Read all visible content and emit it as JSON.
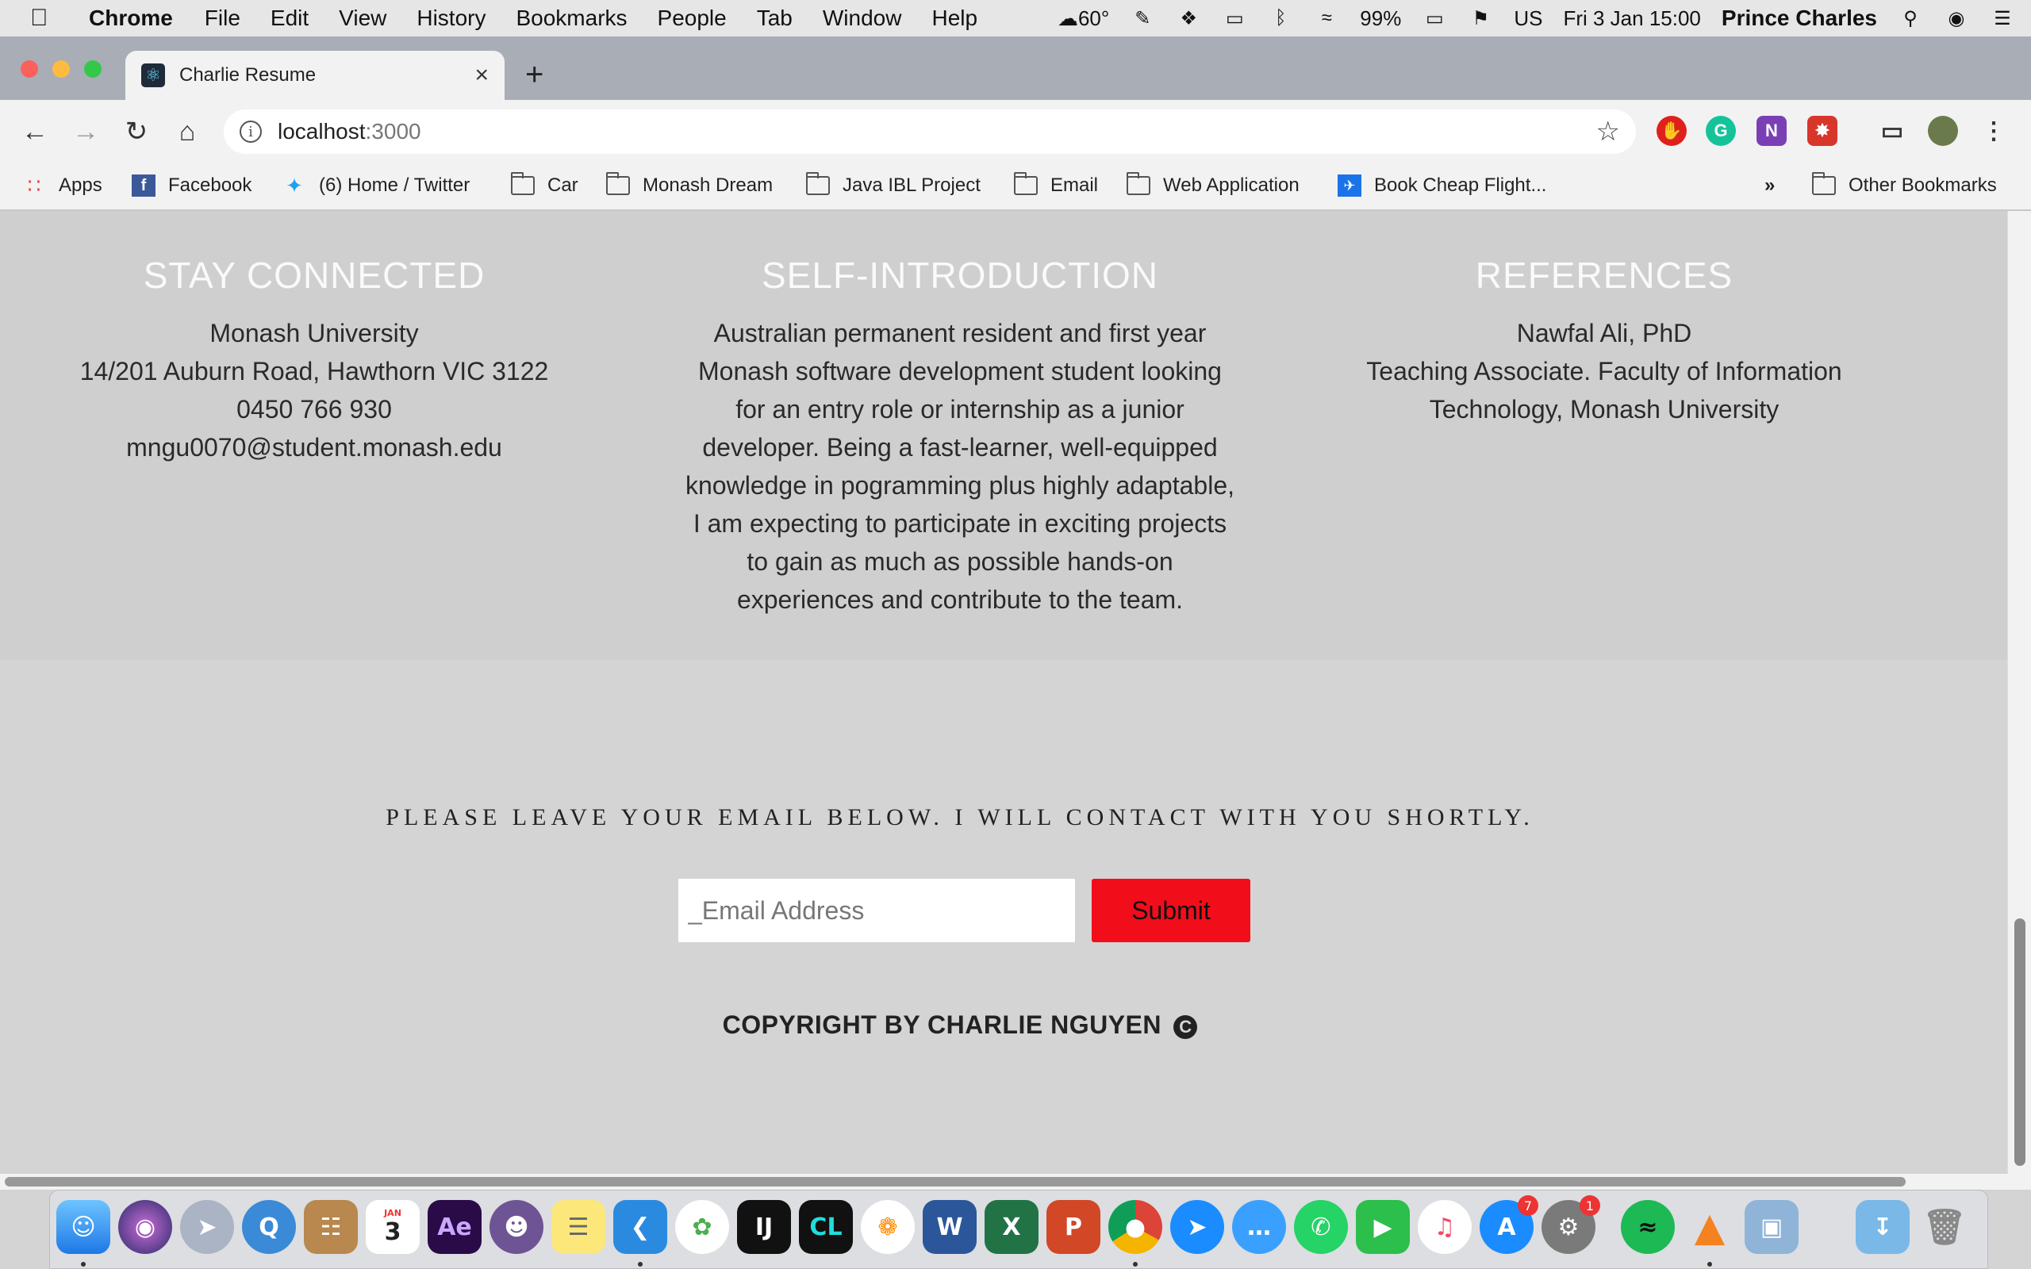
{
  "menubar": {
    "app_name": "Chrome",
    "items": [
      "File",
      "Edit",
      "View",
      "History",
      "Bookmarks",
      "People",
      "Tab",
      "Window",
      "Help"
    ],
    "temperature": "60°",
    "battery": "99%",
    "input_source": "US",
    "datetime": "Fri 3 Jan  15:00",
    "user": "Prince Charles"
  },
  "browser": {
    "tab_title": "Charlie Resume",
    "url_host": "localhost",
    "url_port": ":3000",
    "bookmarks": [
      {
        "label": "Apps",
        "icon": "apps-grid-icon"
      },
      {
        "label": "Facebook",
        "icon": "facebook-icon"
      },
      {
        "label": "(6) Home / Twitter",
        "icon": "twitter-icon"
      },
      {
        "label": "Car",
        "icon": "folder-icon"
      },
      {
        "label": "Monash Dream",
        "icon": "folder-icon"
      },
      {
        "label": "Java IBL Project",
        "icon": "folder-icon"
      },
      {
        "label": "Email",
        "icon": "folder-icon"
      },
      {
        "label": "Web Application",
        "icon": "folder-icon"
      },
      {
        "label": "Book Cheap Flight...",
        "icon": "flight-site-icon"
      }
    ],
    "overflow_label": "»",
    "other_bookmarks": "Other Bookmarks"
  },
  "page": {
    "stay_connected": {
      "title": "STAY CONNECTED",
      "lines": [
        "Monash University",
        "14/201 Auburn Road, Hawthorn VIC 3122",
        "0450 766 930",
        "mngu0070@student.monash.edu"
      ]
    },
    "self_intro": {
      "title": "SELF-INTRODUCTION",
      "lines": [
        "Australian permanent resident and first year",
        "Monash software development student looking",
        "for an entry role or internship as a junior",
        "developer. Being a fast-learner, well-equipped",
        "knowledge in pogramming plus highly adaptable,",
        "I am expecting to participate in exciting projects",
        "to gain as much as possible hands-on",
        "experiences and contribute to the team."
      ]
    },
    "references": {
      "title": "REFERENCES",
      "lines": [
        "Nawfal Ali, PhD",
        "Teaching Associate. Faculty of Information",
        "Technology, Monash University"
      ]
    },
    "contact_prompt": "PLEASE LEAVE YOUR EMAIL BELOW. I WILL CONTACT WITH YOU SHORTLY.",
    "email_placeholder": "_Email Address",
    "submit_label": "Submit",
    "copyright": "COPYRIGHT BY CHARLIE NGUYEN",
    "copyright_symbol": "C"
  },
  "dock": {
    "calendar_month": "JAN",
    "calendar_day": "3",
    "badges": {
      "app_store": "7",
      "system_preferences": "1"
    }
  },
  "colors": {
    "submit_bg": "#f20d1a",
    "section_bg": "#cfcfcf",
    "heading_color": "#fafafa"
  }
}
